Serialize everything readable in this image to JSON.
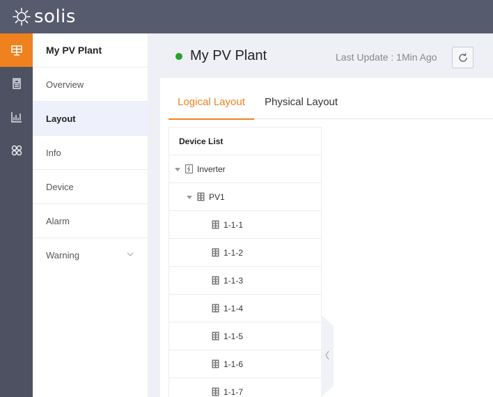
{
  "brand": {
    "name": "solis"
  },
  "rail": {
    "items": [
      {
        "icon": "plant-board-icon",
        "active": true
      },
      {
        "icon": "device-doc-icon",
        "active": false
      },
      {
        "icon": "chart-icon",
        "active": false
      },
      {
        "icon": "apps-grid-icon",
        "active": false
      }
    ]
  },
  "subnav": {
    "title": "My PV Plant",
    "items": [
      {
        "label": "Overview"
      },
      {
        "label": "Layout",
        "active": true
      },
      {
        "label": "Info"
      },
      {
        "label": "Device"
      },
      {
        "label": "Alarm"
      },
      {
        "label": "Warning",
        "has_dropdown": true
      }
    ]
  },
  "header": {
    "plant_name": "My PV Plant",
    "last_update": "Last Update :  1Min Ago",
    "status_color": "#2ca02c"
  },
  "tabs": [
    {
      "label": "Logical Layout",
      "active": true
    },
    {
      "label": "Physical Layout",
      "active": false
    }
  ],
  "device_list": {
    "header": "Device List",
    "tree": [
      {
        "label": "Inverter",
        "level": 0,
        "expanded": true,
        "icon": "inverter-icon"
      },
      {
        "label": "PV1",
        "level": 1,
        "expanded": true,
        "icon": "panel-icon"
      },
      {
        "label": "1-1-1",
        "level": 2,
        "icon": "panel-icon"
      },
      {
        "label": "1-1-2",
        "level": 2,
        "icon": "panel-icon"
      },
      {
        "label": "1-1-3",
        "level": 2,
        "icon": "panel-icon"
      },
      {
        "label": "1-1-4",
        "level": 2,
        "icon": "panel-icon"
      },
      {
        "label": "1-1-5",
        "level": 2,
        "icon": "panel-icon"
      },
      {
        "label": "1-1-6",
        "level": 2,
        "icon": "panel-icon"
      },
      {
        "label": "1-1-7",
        "level": 2,
        "icon": "panel-icon"
      }
    ]
  },
  "colors": {
    "accent": "#f0811f",
    "topbar": "#565c6e",
    "rail": "#4d5161"
  }
}
